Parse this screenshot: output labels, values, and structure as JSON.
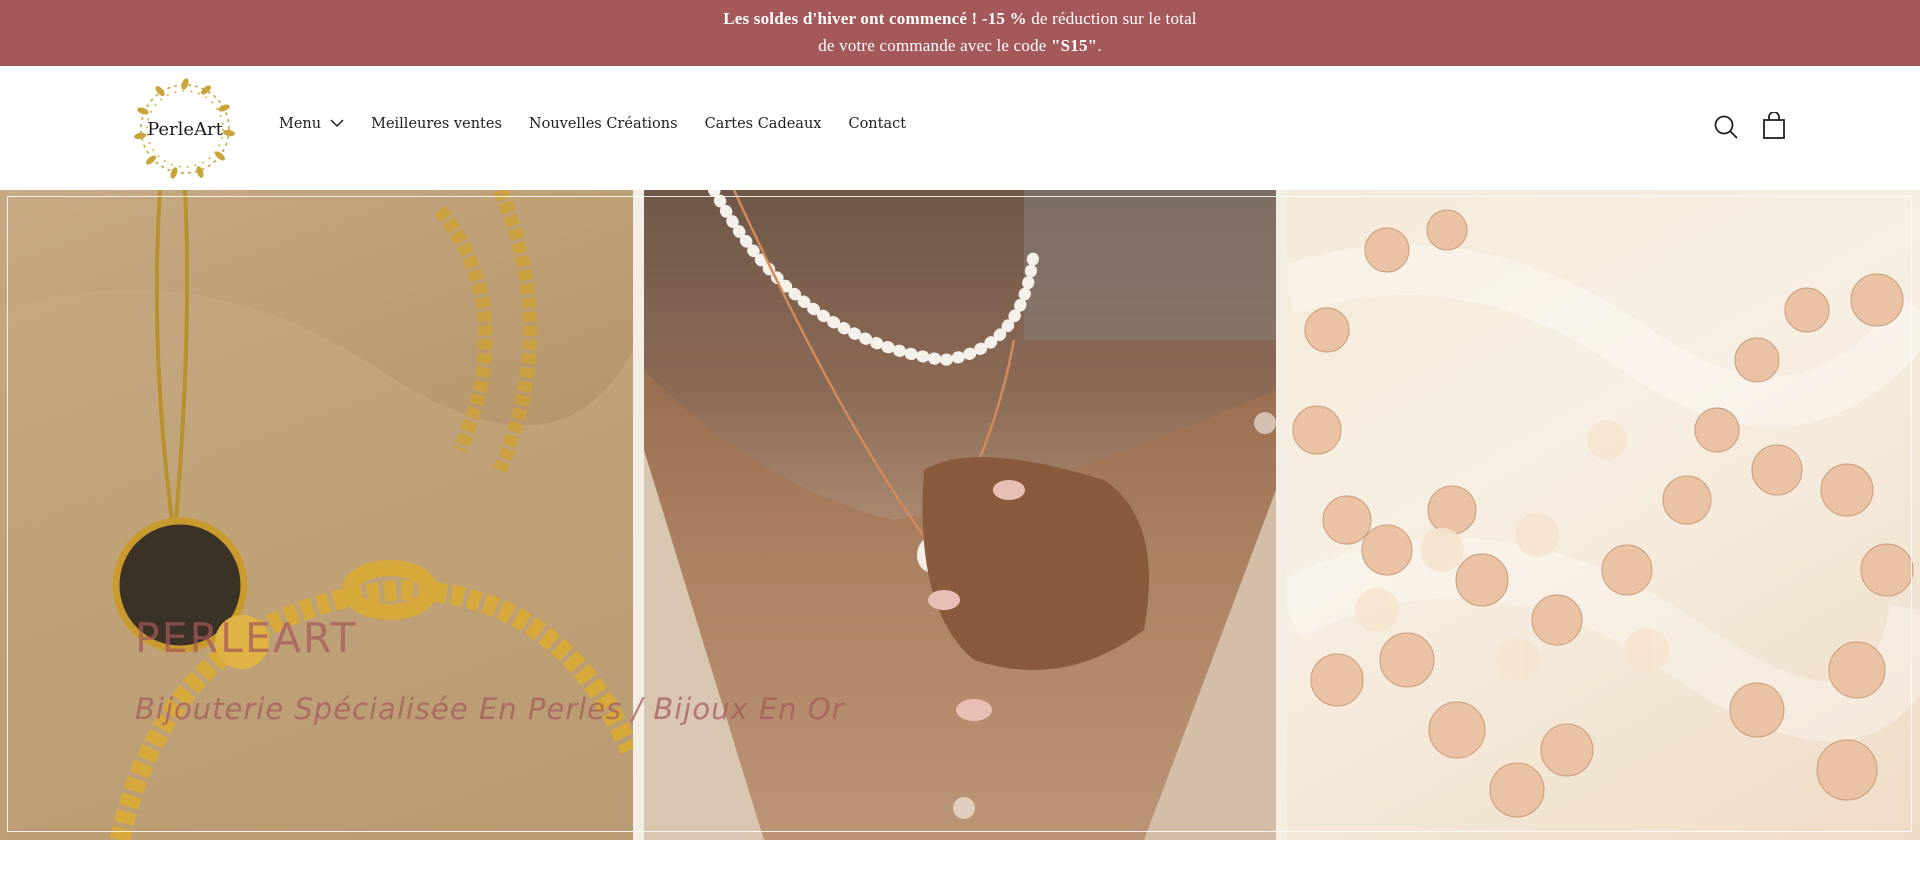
{
  "announcement": {
    "bold_text": "Les soldes d'hiver ont commencé ! -15 %",
    "text_part1": " de réduction sur le total",
    "text_part2": "de votre commande avec le code ",
    "code": "\"S15\"",
    "text_part3": "."
  },
  "header": {
    "logo_text": "PerleArt",
    "nav": [
      {
        "label": "Menu",
        "has_dropdown": true
      },
      {
        "label": "Meilleures ventes"
      },
      {
        "label": "Nouvelles Créations"
      },
      {
        "label": "Cartes Cadeaux"
      },
      {
        "label": "Contact"
      }
    ],
    "icons": {
      "search": "search-icon",
      "cart": "shopping-bag-icon",
      "dropdown": "chevron-down-icon"
    }
  },
  "hero": {
    "title": "PERLEART",
    "subtitle": "Bijouterie Spécialisée En Perles / Bijoux En Or"
  },
  "colors": {
    "accent": "#a5585a",
    "background": "#ffffff",
    "text": "#1e1e1e"
  }
}
